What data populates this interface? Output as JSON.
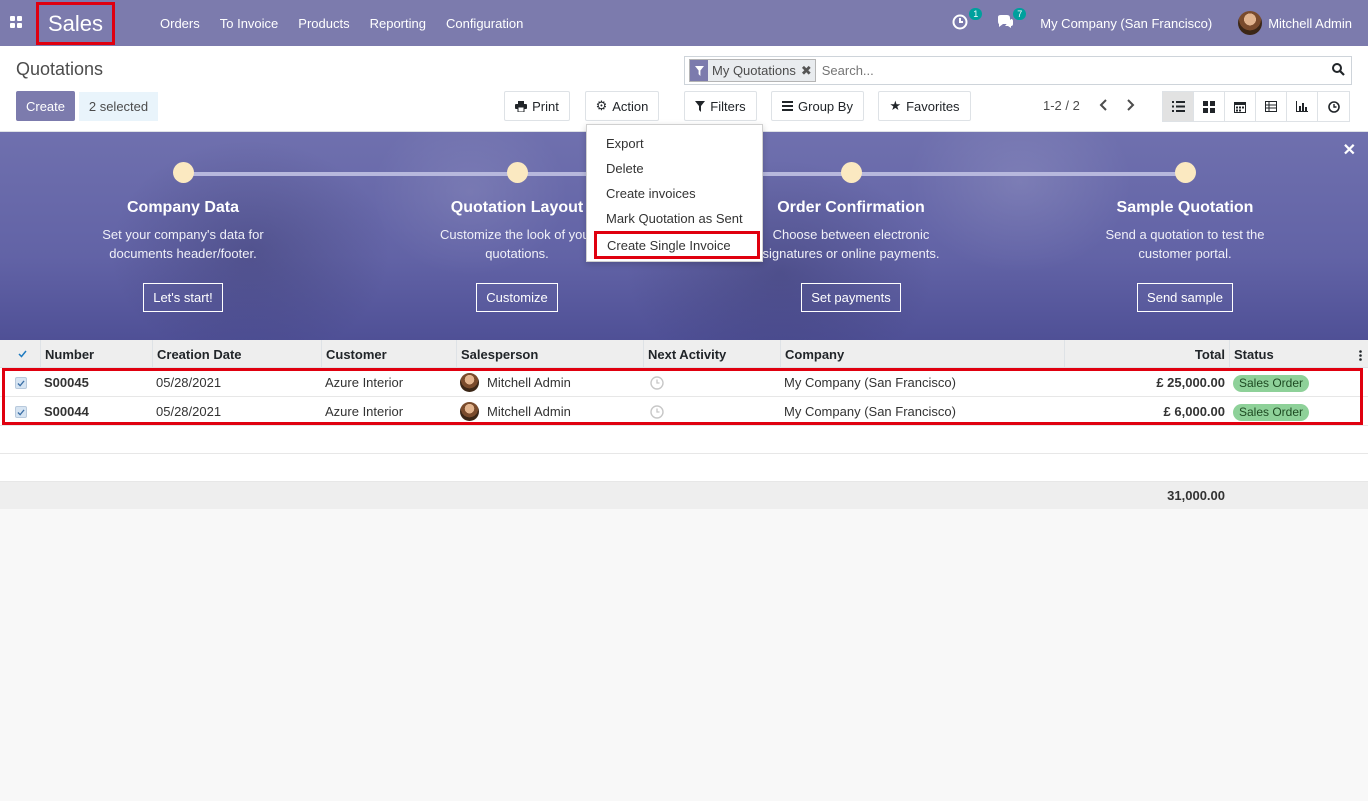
{
  "nav": {
    "brand": "Sales",
    "menu": [
      "Orders",
      "To Invoice",
      "Products",
      "Reporting",
      "Configuration"
    ],
    "activity_count": "1",
    "message_count": "7",
    "company": "My Company (San Francisco)",
    "user": "Mitchell Admin"
  },
  "control": {
    "title": "Quotations",
    "create_label": "Create",
    "selected_label": "2 selected",
    "print_label": "Print",
    "action_label": "Action",
    "filters_label": "Filters",
    "groupby_label": "Group By",
    "favorites_label": "Favorites",
    "facet_label": "My Quotations",
    "search_placeholder": "Search...",
    "pager": "1-2 / 2"
  },
  "action_menu": [
    "Export",
    "Delete",
    "Create invoices",
    "Mark Quotation as Sent",
    "Create Single Invoice"
  ],
  "banner": {
    "steps": [
      {
        "title": "Company Data",
        "desc": "Set your company's data for documents header/footer.",
        "button": "Let's start!"
      },
      {
        "title": "Quotation Layout",
        "desc": "Customize the look of your quotations.",
        "button": "Customize"
      },
      {
        "title": "Order Confirmation",
        "desc": "Choose between electronic signatures or online payments.",
        "button": "Set payments"
      },
      {
        "title": "Sample Quotation",
        "desc": "Send a quotation to test the customer portal.",
        "button": "Send sample"
      }
    ]
  },
  "table": {
    "headers": [
      "Number",
      "Creation Date",
      "Customer",
      "Salesperson",
      "Next Activity",
      "Company",
      "Total",
      "Status"
    ],
    "rows": [
      {
        "number": "S00045",
        "date": "05/28/2021",
        "customer": "Azure Interior",
        "salesperson": "Mitchell Admin",
        "company": "My Company (San Francisco)",
        "total": "£ 25,000.00",
        "status": "Sales Order"
      },
      {
        "number": "S00044",
        "date": "05/28/2021",
        "customer": "Azure Interior",
        "salesperson": "Mitchell Admin",
        "company": "My Company (San Francisco)",
        "total": "£ 6,000.00",
        "status": "Sales Order"
      }
    ],
    "footer_total": "31,000.00"
  }
}
